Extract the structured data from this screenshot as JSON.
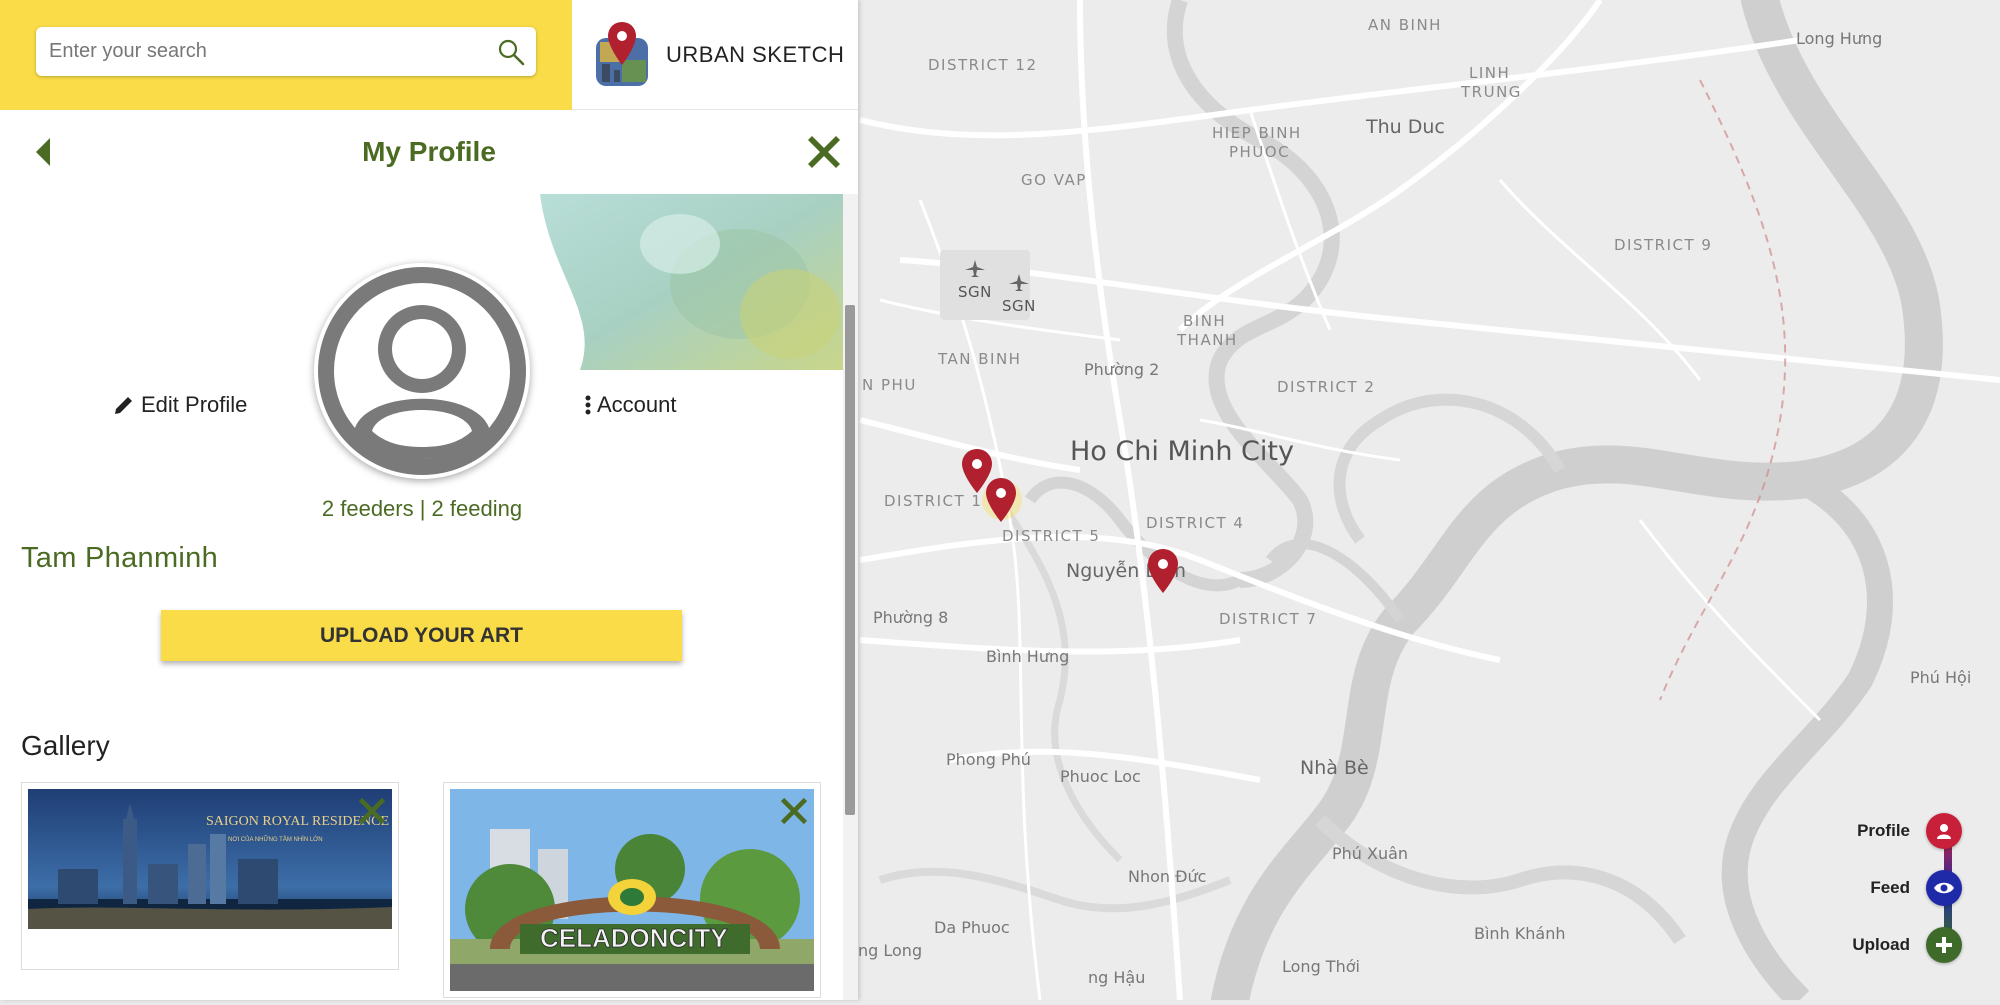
{
  "search": {
    "placeholder": "Enter your search"
  },
  "brand": {
    "name": "URBAN SKETCH"
  },
  "header": {
    "title": "My Profile"
  },
  "profile": {
    "edit_label": "Edit Profile",
    "account_label": "Account",
    "stats": "2 feeders | 2 feeding",
    "name": "Tam Phanminh",
    "upload_label": "UPLOAD YOUR ART"
  },
  "gallery": {
    "title": "Gallery",
    "items": [
      {
        "caption": "SAIGON ROYAL RESIDENCE",
        "subcaption": "NƠI CỦA NHỮNG TẦM NHÌN LỚN"
      },
      {
        "caption": "CELADONCITY"
      }
    ]
  },
  "map": {
    "city": "Ho Chi Minh City",
    "districts": [
      "DISTRICT 12",
      "AN BINH",
      "LINH",
      "TRUNG",
      "HIEP BINH",
      "PHUOC",
      "GO VAP",
      "DISTRICT 9",
      "BINH",
      "THANH",
      "TAN BINH",
      "DISTRICT 2",
      "N PHU",
      "DISTRICT 1",
      "DISTRICT 5",
      "DISTRICT 4",
      "DISTRICT 7"
    ],
    "towns": [
      "Thu Duc",
      "Nguyễn Lâm",
      "Nhà Bè",
      "Long Hưng"
    ],
    "suburbs": [
      "Phường 2",
      "Phường 8",
      "Bình Hưng",
      "Phong Phú",
      "Phuoc Loc",
      "Phú Xuân",
      "Nhon Đức",
      "Da Phuoc",
      "Bình Khánh",
      "Long Thới",
      "ng Long",
      "ng Hậu",
      "Phú Hội"
    ],
    "airports": [
      "SGN",
      "SGN"
    ]
  },
  "fab": {
    "profile": "Profile",
    "feed": "Feed",
    "upload": "Upload"
  },
  "colors": {
    "yellow": "#f9dc47",
    "green": "#4b6b23",
    "pin_red": "#b0202e",
    "profile_btn": "#c8203a",
    "feed_btn": "#1f2aa8",
    "upload_btn": "#3e6a2a"
  }
}
